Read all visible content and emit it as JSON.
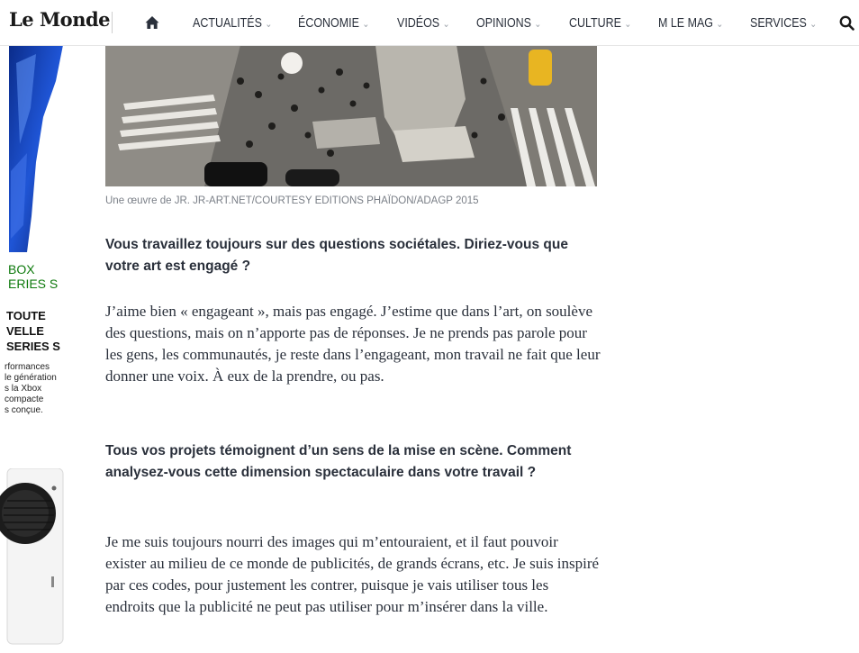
{
  "nav": {
    "logo": "Le Monde",
    "items": [
      {
        "label": "ACTUALITÉS"
      },
      {
        "label": "ÉCONOMIE"
      },
      {
        "label": "VIDÉOS"
      },
      {
        "label": "OPINIONS"
      },
      {
        "label": "CULTURE"
      },
      {
        "label": "M LE MAG"
      },
      {
        "label": "SERVICES"
      }
    ],
    "chevron": "⌄"
  },
  "ad": {
    "brand": "BOX\nERIES S",
    "headline": "TOUTE\nVELLE\nSERIES S",
    "copy": "rformances\nle génération\ns la Xbox\ncompacte\ns conçue.",
    "accent": "#0e7a0d"
  },
  "article": {
    "caption": "Une œuvre de JR. JR-ART.NET/COURTESY EDITIONS PHAÏDON/ADAGP 2015",
    "q1": "Vous travaillez toujours sur des questions sociétales. Diriez-vous que votre art est engagé ?",
    "a1": "J’aime bien « engageant », mais pas engagé. J’estime que dans l’art, on soulève des questions, mais on n’apporte pas de réponses. Je ne prends pas parole pour les gens, les communautés, je reste dans l’engageant, mon travail ne fait que leur donner une voix. À eux de la prendre, ou pas.",
    "q2": "Tous vos projets témoignent d’un sens de la mise en scène. Comment analysez-vous cette dimension spectaculaire dans votre travail ?",
    "a2": "Je me suis toujours nourri des images qui m’entouraient, et il faut pouvoir exister au milieu de ce monde de publicités, de grands écrans, etc. Je suis inspiré par ces codes, pour justement les contrer, puisque je vais utiliser tous les endroits que la publicité ne peut pas utiliser pour m’insérer dans la ville."
  }
}
